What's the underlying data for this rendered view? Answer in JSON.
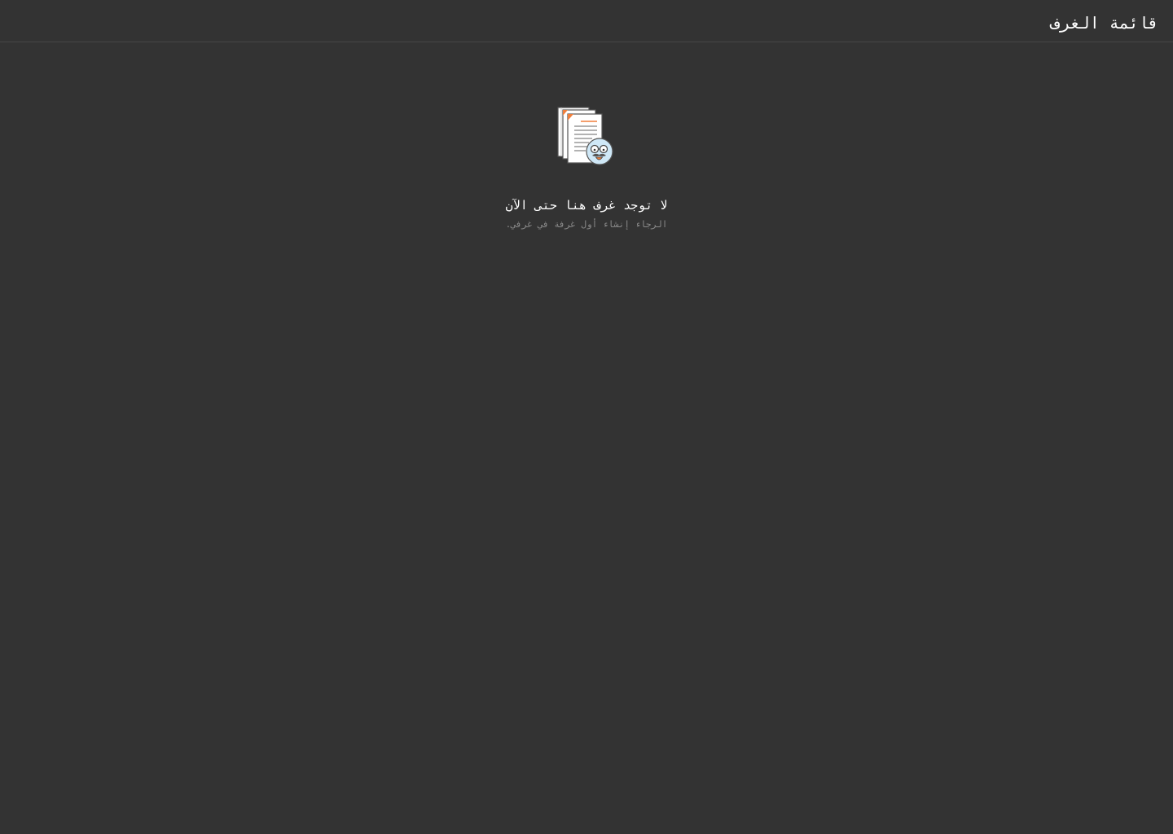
{
  "header": {
    "title": "قائمة الغرف"
  },
  "empty_state": {
    "icon": "documents-avatar-icon",
    "title": "لا توجد غرف هنا حتى الآن",
    "subtitle": "الرجاء إنشاء أول غرفة في غرفي."
  },
  "colors": {
    "background": "#333333",
    "divider": "#474747",
    "title_text": "#ffffff",
    "subtitle_text": "#8a8a8a",
    "accent_orange": "#f07f3c",
    "avatar_blue": "#cfe8f7"
  }
}
